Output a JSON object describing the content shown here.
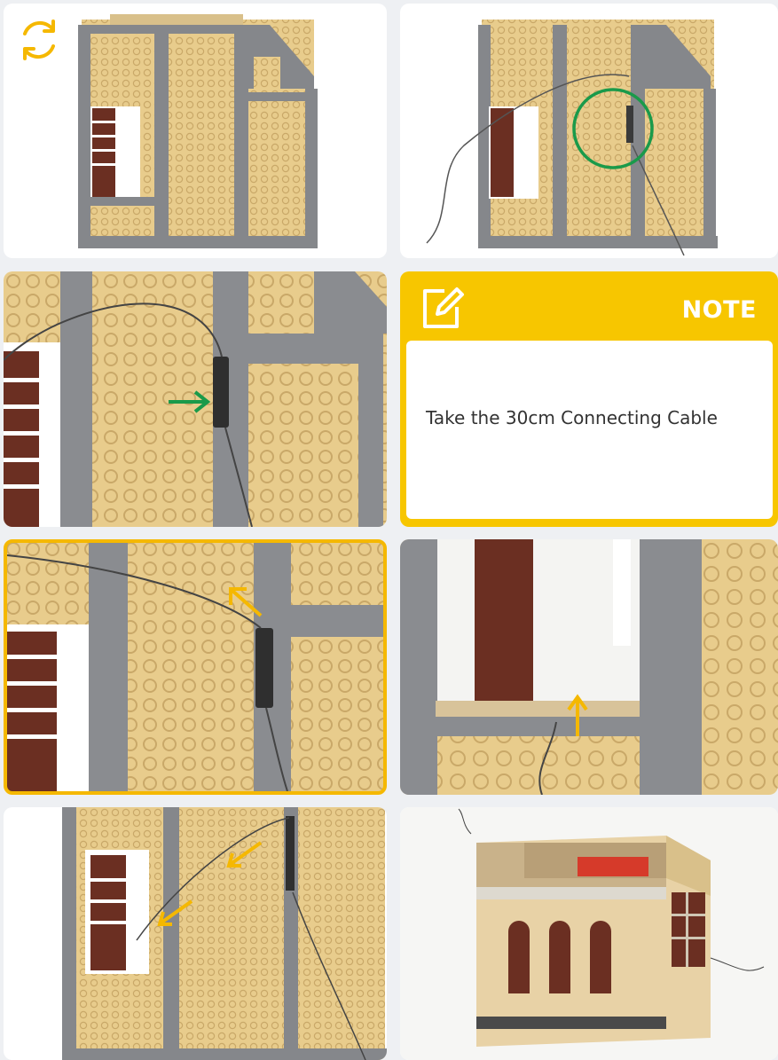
{
  "note": {
    "title": "NOTE",
    "text": "Take the 30cm Connecting Cable"
  },
  "icons": {
    "refresh": "refresh-icon",
    "note": "edit-note-icon"
  },
  "colors": {
    "accent": "#f5b800",
    "highlight_circle": "#1a9a4a",
    "tan_plate": "#e8cc8c",
    "grey_frame": "#8a8c90",
    "brown_brick": "#6b2f22"
  },
  "gallery": {
    "images": [
      "build-step-1",
      "build-step-2",
      "build-step-3",
      "build-step-4",
      "build-step-5",
      "build-step-6",
      "build-step-7"
    ],
    "selected_index": 3
  }
}
